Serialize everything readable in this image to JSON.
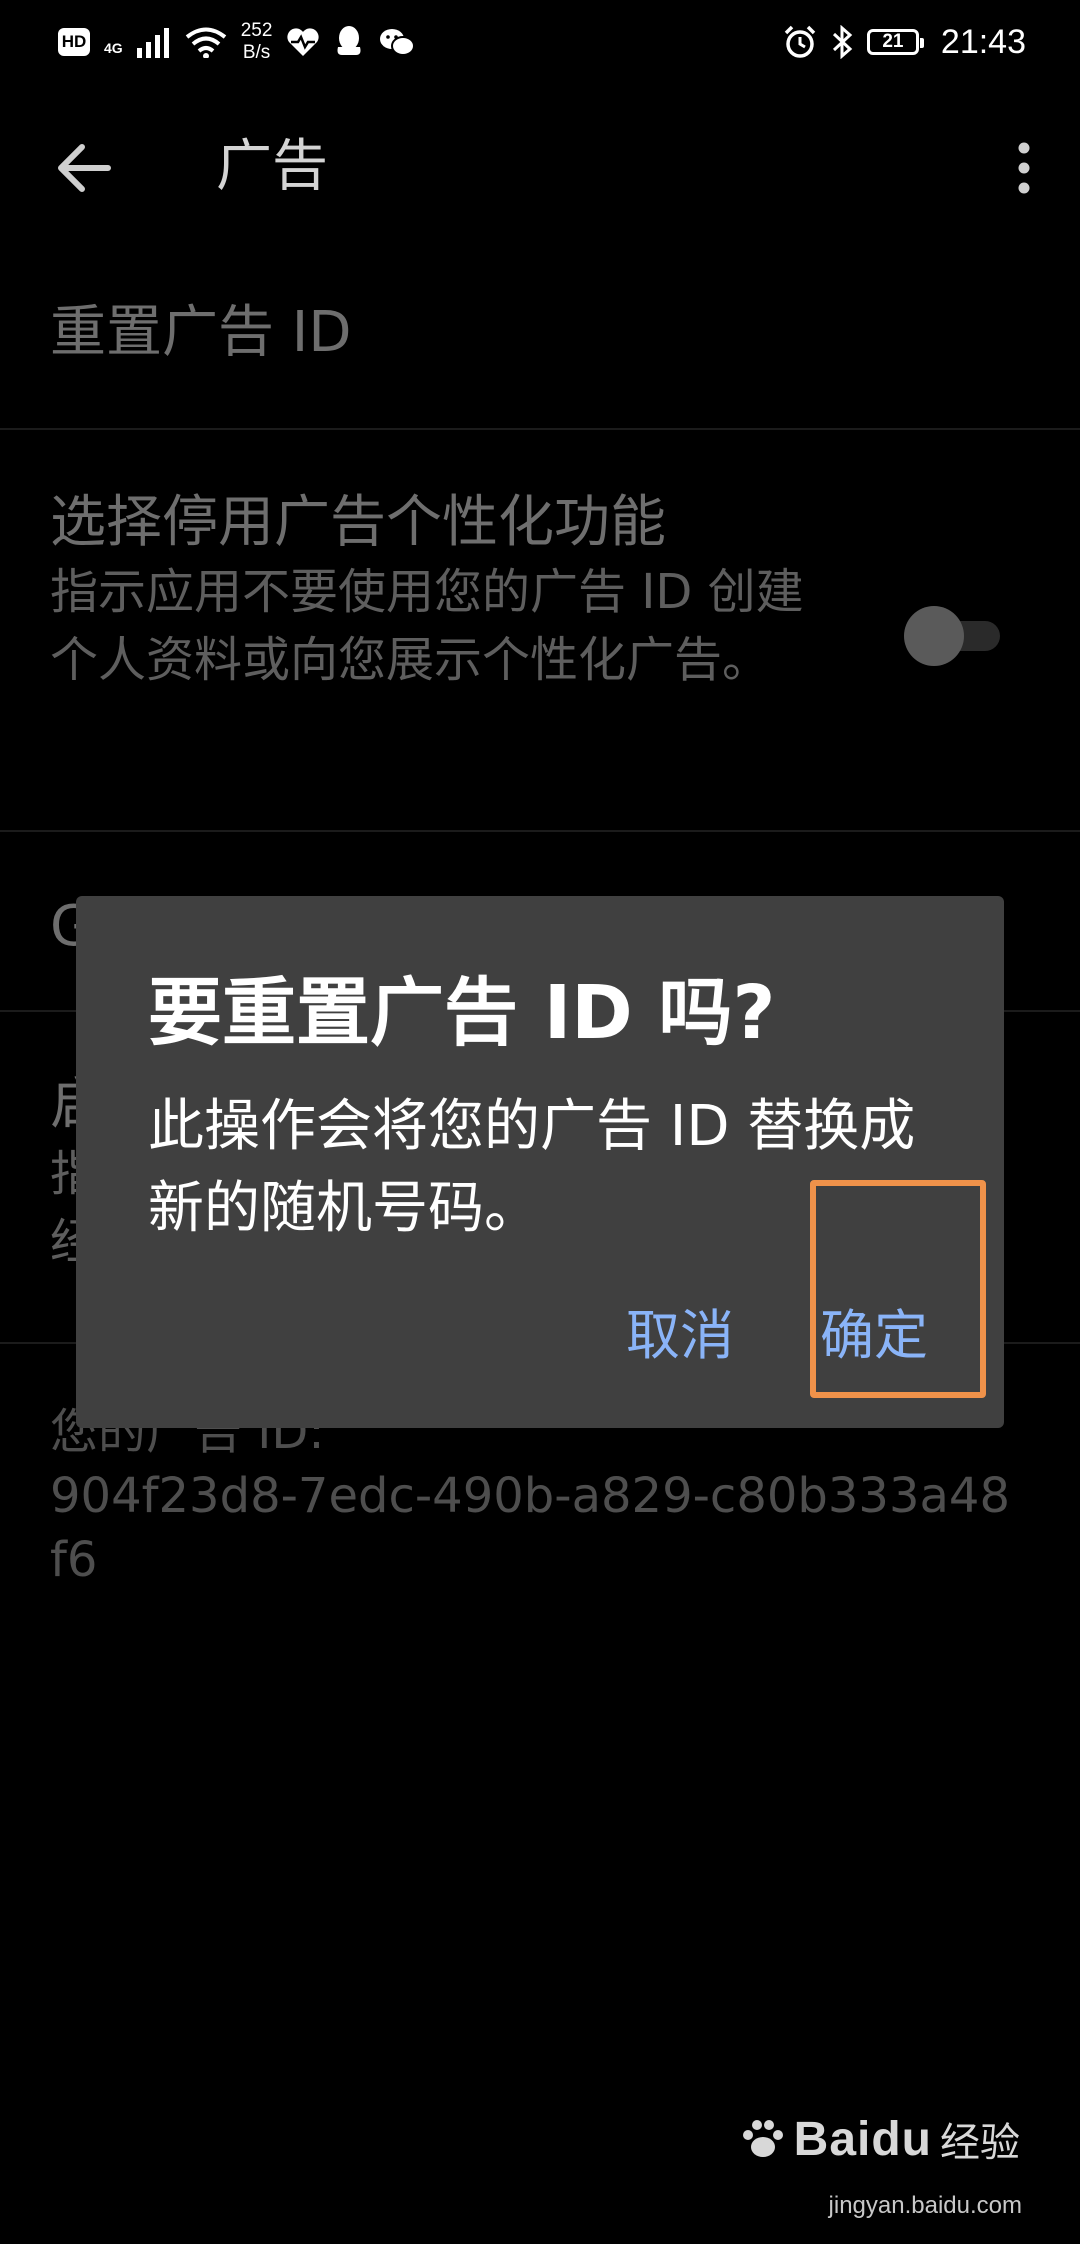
{
  "status_bar": {
    "hd": "HD",
    "network_type": "4G",
    "speed_value": "252",
    "speed_unit": "B/s",
    "battery": "21",
    "time": "21:43"
  },
  "app_bar": {
    "title": "广告"
  },
  "settings": {
    "reset_title": "重置广告 ID",
    "opt_out_title": "选择停用广告个性化功能",
    "opt_out_summary": "指示应用不要使用您的广告 ID 创建个人资料或向您展示个性化广告。",
    "opt_out_enabled": false,
    "row3_visible_char": "G",
    "row4_lines": [
      "启",
      "指",
      "经"
    ],
    "id_label": "您的广告 ID:",
    "id_value": "904f23d8-7edc-490b-a829-c80b333a48f6"
  },
  "dialog": {
    "title": "要重置广告 ID 吗?",
    "message": "此操作会将您的广告 ID 替换成新的随机号码。",
    "cancel_label": "取消",
    "ok_label": "确定"
  },
  "highlight_color": "#f0924a",
  "accent_color": "#8ab4f8",
  "watermark": {
    "brand": "Baidu",
    "suffix": "经验",
    "url": "jingyan.baidu.com"
  }
}
